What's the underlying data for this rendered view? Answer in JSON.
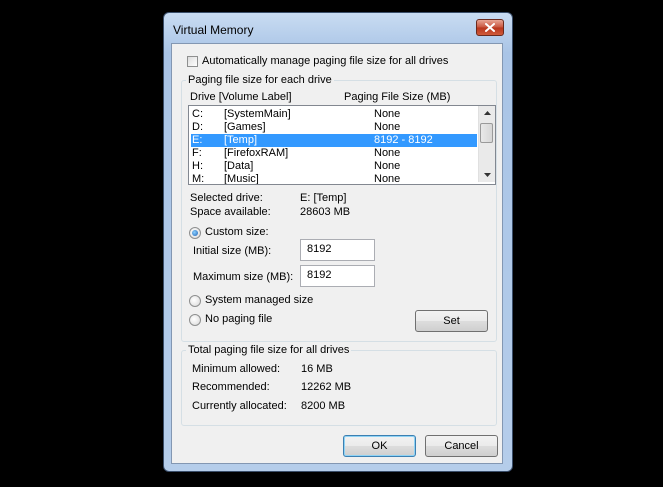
{
  "window": {
    "title": "Virtual Memory"
  },
  "auto_manage": {
    "label": "Automatically manage paging file size for all drives",
    "checked": false
  },
  "paging_group": {
    "title": "Paging file size for each drive",
    "col_drive": "Drive  [Volume Label]",
    "col_size": "Paging File Size (MB)",
    "drives": [
      {
        "letter": "C:",
        "label": "[SystemMain]",
        "size": "None",
        "selected": false
      },
      {
        "letter": "D:",
        "label": "[Games]",
        "size": "None",
        "selected": false
      },
      {
        "letter": "E:",
        "label": "[Temp]",
        "size": "8192 - 8192",
        "selected": true
      },
      {
        "letter": "F:",
        "label": "[FirefoxRAM]",
        "size": "None",
        "selected": false
      },
      {
        "letter": "H:",
        "label": "[Data]",
        "size": "None",
        "selected": false
      },
      {
        "letter": "M:",
        "label": "[Music]",
        "size": "None",
        "selected": false
      }
    ],
    "selected_drive_label": "Selected drive:",
    "selected_drive_value": "E:  [Temp]",
    "space_available_label": "Space available:",
    "space_available_value": "28603 MB",
    "custom_size_label": "Custom size:",
    "initial_size_label": "Initial size (MB):",
    "initial_size_value": "8192",
    "max_size_label": "Maximum size (MB):",
    "max_size_value": "8192",
    "system_managed_label": "System managed size",
    "no_paging_label": "No paging file",
    "set_label": "Set"
  },
  "total_group": {
    "title": "Total paging file size for all drives",
    "min_label": "Minimum allowed:",
    "min_value": "16 MB",
    "rec_label": "Recommended:",
    "rec_value": "12262 MB",
    "cur_label": "Currently allocated:",
    "cur_value": "8200 MB"
  },
  "buttons": {
    "ok": "OK",
    "cancel": "Cancel"
  },
  "colors": {
    "selection": "#3399ff",
    "titlebar": "#b9d1ea",
    "close": "#c8533c"
  }
}
